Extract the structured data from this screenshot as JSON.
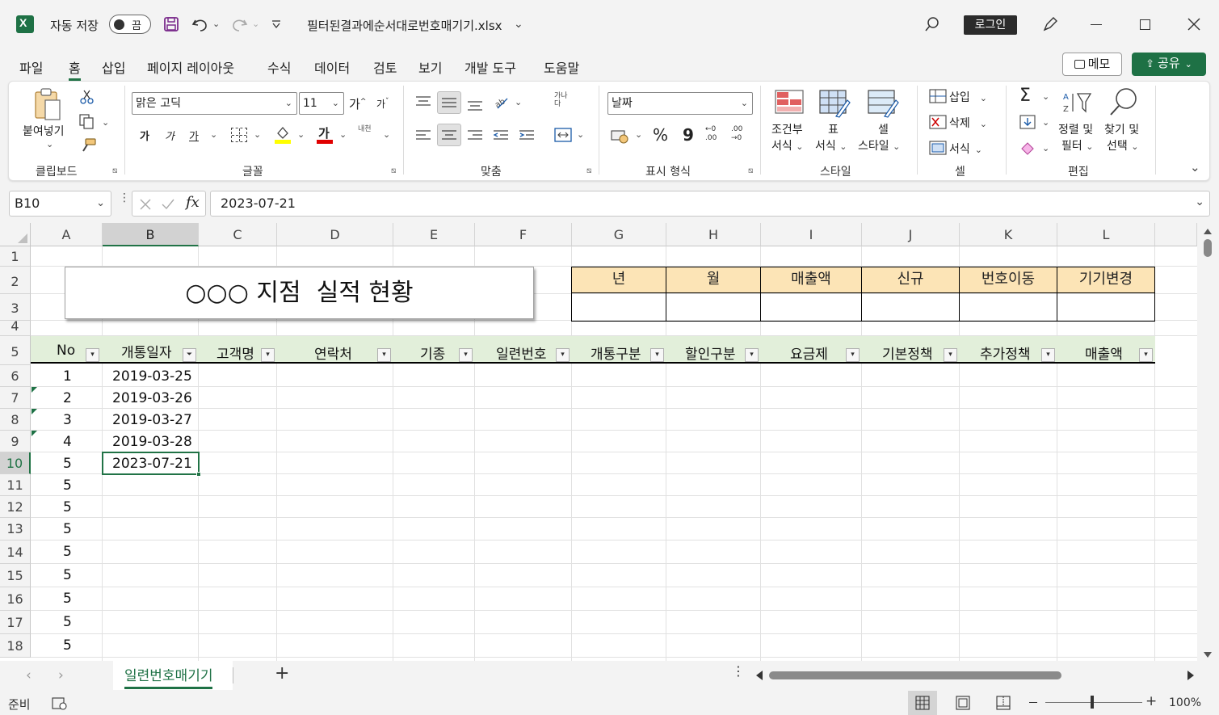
{
  "titlebar": {
    "autosave_label": "자동 저장",
    "autosave_state": "끔",
    "filename": "필터된결과에순서대로번호매기기.xlsx",
    "login_label": "로그인"
  },
  "menu": {
    "items": [
      "파일",
      "홈",
      "삽입",
      "페이지 레이아웃",
      "수식",
      "데이터",
      "검토",
      "보기",
      "개발 도구",
      "도움말"
    ],
    "active": "홈",
    "memo_label": "메모",
    "share_label": "공유"
  },
  "ribbon": {
    "clipboard": {
      "paste_label": "붙여넣기",
      "group_label": "클립보드"
    },
    "font": {
      "font_name": "맑은 고딕",
      "font_size": "11",
      "grow": "가",
      "shrink": "가",
      "bold": "가",
      "italic": "가",
      "underline": "가",
      "font_color_glyph": "가",
      "phonetic": "내천",
      "group_label": "글꼴"
    },
    "alignment": {
      "wrap_glyph": "가나다",
      "group_label": "맞춤"
    },
    "number": {
      "format": "날짜",
      "percent": "%",
      "comma": "9",
      "inc_decimal": "←0 .00",
      "dec_decimal": ".00 →0",
      "group_label": "표시 형식"
    },
    "styles": {
      "cond_format_1": "조건부",
      "cond_format_2": "서식",
      "table_format_1": "표",
      "table_format_2": "서식",
      "cell_styles_1": "셀",
      "cell_styles_2": "스타일",
      "group_label": "스타일"
    },
    "cells": {
      "insert": "삽입",
      "delete": "삭제",
      "format": "서식",
      "group_label": "셀"
    },
    "editing": {
      "sort_1": "정렬 및",
      "sort_2": "필터",
      "find_1": "찾기 및",
      "find_2": "선택",
      "group_label": "편집"
    }
  },
  "formula_bar": {
    "name_box": "B10",
    "fx": "fx",
    "value": "2023-07-21"
  },
  "columns": [
    "A",
    "B",
    "C",
    "D",
    "E",
    "F",
    "G",
    "H",
    "I",
    "J",
    "K",
    "L"
  ],
  "selected_column": "B",
  "rows": [
    "1",
    "2",
    "3",
    "4",
    "5",
    "6",
    "7",
    "8",
    "9",
    "10",
    "11",
    "12",
    "13",
    "14",
    "15",
    "16",
    "17",
    "18"
  ],
  "selected_row": "10",
  "sheet": {
    "title_box": "○○○ 지점  실적 현황",
    "summary_headers": [
      "년",
      "월",
      "매출액",
      "신규",
      "번호이동",
      "기기변경"
    ],
    "table_headers": [
      "No",
      "개통일자",
      "고객명",
      "연락처",
      "기종",
      "일련번호",
      "개통구분",
      "할인구분",
      "요금제",
      "기본정책",
      "추가정책",
      "매출액"
    ],
    "no_values": [
      "1",
      "2",
      "3",
      "4",
      "5",
      "5",
      "5",
      "5",
      "5",
      "5",
      "5",
      "5",
      "5"
    ],
    "date_values": [
      "2019-03-25",
      "2019-03-26",
      "2019-03-27",
      "2019-03-28",
      "2023-07-21"
    ]
  },
  "sheet_tabs": {
    "active": "일련번호매기기",
    "add": "+"
  },
  "status": {
    "ready": "준비",
    "zoom": "100%"
  }
}
